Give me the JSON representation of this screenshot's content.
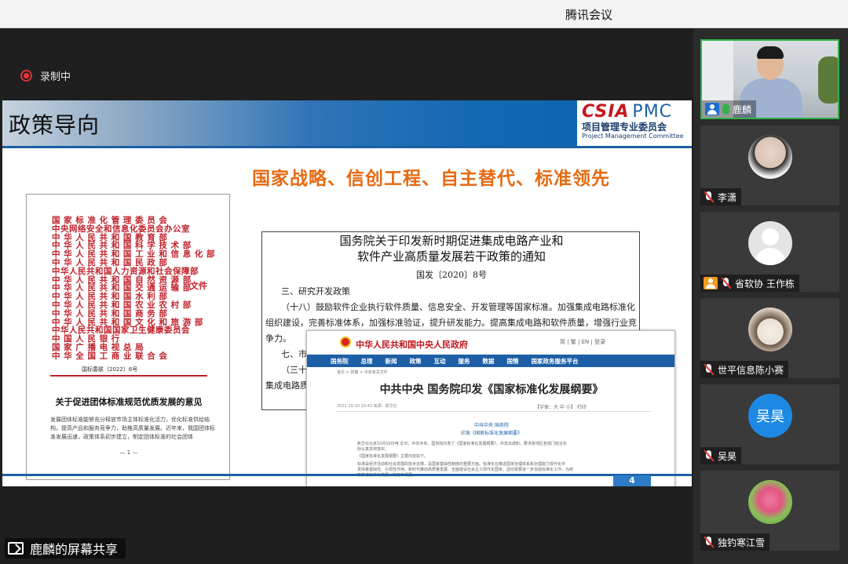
{
  "window": {
    "title": "腾讯会议"
  },
  "recording": {
    "label": "录制中"
  },
  "slide": {
    "title": "政策导向",
    "logo": {
      "brand": "CSIA",
      "brand2": "PMC",
      "subtitle": "项目管理专业委员会",
      "english": "Project Management Committee"
    },
    "slogan": "国家战略、信创工程、自主替代、标准领先",
    "left_doc": {
      "orgs": [
        "国 家 标 准 化 管 理 委 员 会",
        "中央网络安全和信息化委员会办公室",
        "中 华 人 民 共 和 国 教 育 部",
        "中 华 人 民 共 和 国 科 学 技 术 部",
        "中 华 人 民 共 和 国 工 业 和 信 息 化 部",
        "中 华 人 民 共 和 国 民 政 部",
        "中华人民共和国人力资源和社会保障部",
        "中 华 人 民 共 和 国 自 然 资 源 部",
        "中 华 人 民 共 和 国 交 通 运 输 部",
        "中 华 人 民 共 和 国 水 利 部",
        "中 华 人 民 共 和 国 农 业 农 村 部",
        "中 华 人 民 共 和 国 商 务 部",
        "中 华 人 民 共 和 国 文 化 和 旅 游 部",
        "中华人民共和国国家卫生健康委员会",
        "中 国 人 民 银 行",
        "国 家 广 播 电 视 总 局",
        "中 华 全 国 工 商 业 联 合 会"
      ],
      "wenjian": "文件",
      "doc_no": "国标委联〔2022〕6号",
      "heading": "关于促进团体标准规范优质发展的意见",
      "body": "发展团体标准能够充分释放市场主体标准化活力，优化标准供给结构，提高产品和服务竞争力，助推高质量发展。近年来，我国团体标准发展迅速，政策体系初步建立，制定团体标准的社会团体",
      "page_no": "— 1 —"
    },
    "mid_doc": {
      "title_line1": "国务院关于印发新时期促进集成电路产业和",
      "title_line2": "软件产业高质量发展若干政策的通知",
      "doc_no": "国发〔2020〕8号",
      "section": "三、研究开发政策",
      "para1": "（十八）鼓励软件企业执行软件质量、信息安全、开发管理等国家标准。加强集成电路标准化",
      "para2": "组织建设，完善标准体系，加强标准验证，提升研发能力。提高集成电路和软件质量，增强行业竞",
      "para3": "争力。",
      "frag1": "七、市",
      "frag2": "（三十",
      "frag3": "集成电路质"
    },
    "news": {
      "site": "中华人民共和国中央人民政府",
      "tools": "简 | 繁 | EN | 登录",
      "nav": [
        "国务院",
        "总理",
        "新闻",
        "政策",
        "互动",
        "服务",
        "数据",
        "国情",
        "国家政务服务平台"
      ],
      "crumb": "首页 > 政策 > 中央有关文件",
      "headline": "中共中央 国务院印发《国家标准化发展纲要》",
      "meta": "2021-10-10 20:43   来源：新华社",
      "meta_right": "【字体：大 中 小】  打印",
      "author": "中共中央 国务院",
      "subtitle": "印发《国家标准化发展纲要》",
      "lines": [
        "新华社北京10月10日电  近日，中共中央、国务院印发了《国家标准化发展纲要》，并发出通知，要求各地区各部门结合实",
        "际认真贯彻落实。",
        "《国家标准化发展纲要》主要内容如下。",
        "标准是经济活动和社会发展的技术支撑，是国家基础性制度的重要方面。标准化在推进国家治理体系和治理能力现代化中",
        "发挥着基础性、引领性作用。新时代推动高质量发展、全面建设社会主义现代化国家，迫切需要进一步加强标准化工作。为统",
        "筹推进标准化发展，制定本纲要。"
      ]
    },
    "page_number": "4"
  },
  "share": {
    "label": "鹿麟的屏幕共享"
  },
  "participants": [
    {
      "name": "鹿麟",
      "mic": "on",
      "role": "host",
      "kind": "video"
    },
    {
      "name": "李潇",
      "mic": "off",
      "kind": "photo"
    },
    {
      "name": "省软协 王作栋",
      "mic": "off",
      "role": "orange",
      "kind": "default"
    },
    {
      "name": "世平信息陈小赛",
      "mic": "off",
      "kind": "dog"
    },
    {
      "name": "吴昊",
      "mic": "off",
      "kind": "text",
      "avatar_text": "吴昊"
    },
    {
      "name": "独钓寒江雪",
      "mic": "off",
      "kind": "lotus"
    }
  ]
}
